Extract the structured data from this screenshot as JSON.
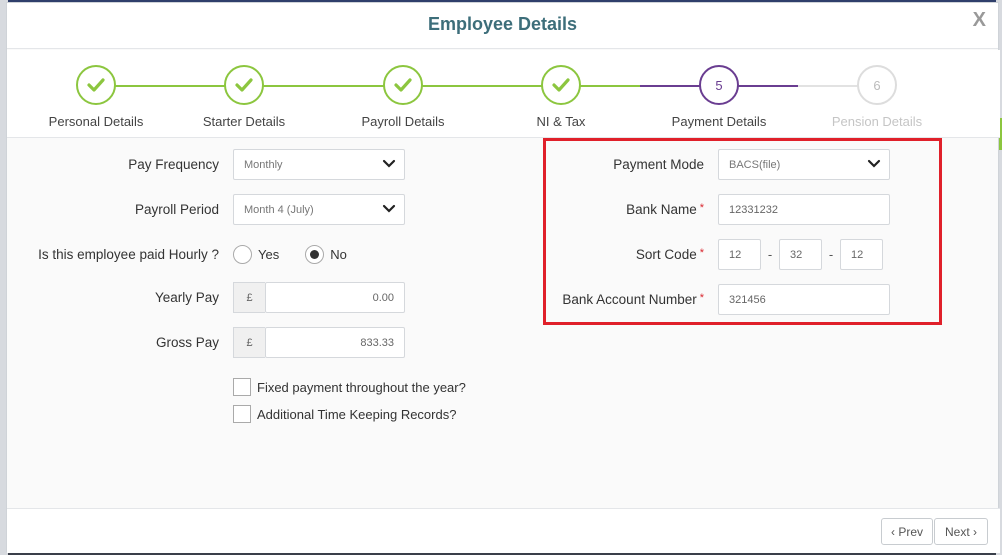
{
  "modal": {
    "title": "Employee Details",
    "close": "X"
  },
  "steps": [
    {
      "label": "Personal Details",
      "state": "done",
      "number": ""
    },
    {
      "label": "Starter Details",
      "state": "done",
      "number": ""
    },
    {
      "label": "Payroll Details",
      "state": "done",
      "number": ""
    },
    {
      "label": "NI & Tax",
      "state": "done",
      "number": ""
    },
    {
      "label": "Payment Details",
      "state": "active",
      "number": "5"
    },
    {
      "label": "Pension Details",
      "state": "pending",
      "number": "6"
    }
  ],
  "form": {
    "pay_frequency": {
      "label": "Pay Frequency",
      "value": "Monthly"
    },
    "payroll_period": {
      "label": "Payroll Period",
      "value": "Month 4 (July)"
    },
    "paid_hourly": {
      "label": "Is this employee paid Hourly ?",
      "yes": "Yes",
      "no": "No",
      "selected": "No"
    },
    "yearly_pay": {
      "label": "Yearly Pay",
      "currency": "£",
      "value": "0.00"
    },
    "gross_pay": {
      "label": "Gross Pay",
      "currency": "£",
      "value": "833.33"
    },
    "fixed_payment": {
      "label": "Fixed payment throughout the year?"
    },
    "time_keeping": {
      "label": "Additional Time Keeping Records?"
    },
    "payment_mode": {
      "label": "Payment Mode",
      "value": "BACS(file)"
    },
    "bank_name": {
      "label": "Bank Name",
      "value": "12331232"
    },
    "sort_code": {
      "label": "Sort Code",
      "part1": "12",
      "part2": "32",
      "part3": "12",
      "sep": "-"
    },
    "account_number": {
      "label": "Bank Account Number",
      "value": "321456"
    },
    "required_mark": "*"
  },
  "footer": {
    "prev": "‹ Prev",
    "next": "Next ›"
  },
  "colors": {
    "done": "#8cc63f",
    "active": "#6a3d91",
    "pending": "#dddddd",
    "highlight": "#e0202a"
  }
}
